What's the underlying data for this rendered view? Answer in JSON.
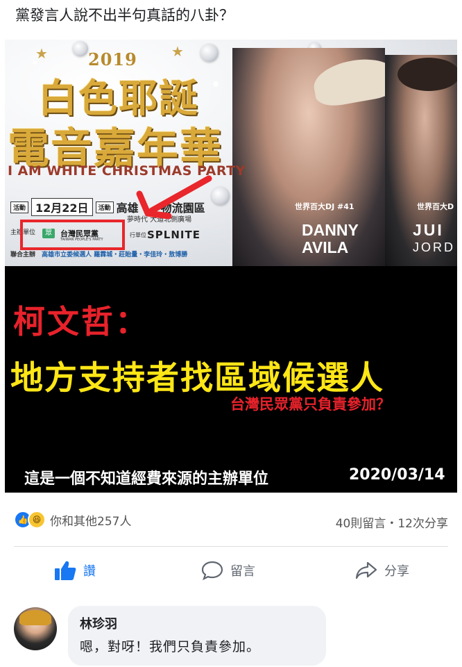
{
  "post": {
    "text": "黨發言人說不出半句真話的八卦？"
  },
  "poster": {
    "year": "2019",
    "title_line1": "白色耶誕",
    "title_line2": "電音嘉年華",
    "subtitle": "I AM WHITE CHRISTMAS PARTY",
    "tag_activity": "活動",
    "date": "12月22日",
    "tag_activity2": "活動",
    "venue": "高雄",
    "venue_rest": "物流園區",
    "venue_sub": "夢時代    大道北側廣場",
    "organizer_label": "主辦單位",
    "organizer_name": "台灣民眾黨",
    "organizer_sub": "TAIWAN PEOPLE'S PARTY",
    "executor_label": "行單位",
    "executor_name": "SPLNITE",
    "cohost_label": "聯合主辦",
    "cohost": "高雄市立委候選人 羅霖城・莊貽量・李佳玲・敖博勝",
    "dj1_tag": "世界百大DJ #41",
    "dj1_name_line1": "DANNY",
    "dj1_name_line2": "AVILA",
    "dj2_tag": "世界百大D",
    "dj2_name_line1": "JUI",
    "dj2_name_line2": "JORD"
  },
  "banner": {
    "name": "柯文哲：",
    "headline": "地方支持者找區域候選人",
    "question": "台灣民眾黨只負責參加？",
    "footer": "這是一個不知道經費來源的主辦單位",
    "date": "2020/03/14"
  },
  "reactions": {
    "summary": "你和其他257人",
    "counts": "40則留言・12次分享",
    "like_icon": "like-icon",
    "haha_icon": "haha-icon"
  },
  "actions": {
    "like": "讚",
    "comment": "留言",
    "share": "分享"
  },
  "comment": {
    "author": "林珍羽",
    "text": "嗯，對呀！我們只負責參加。"
  },
  "colors": {
    "brand_blue": "#1877f2",
    "banner_red": "#e8222b",
    "banner_yellow": "#ffe616",
    "highlight_red": "#e8262b"
  }
}
